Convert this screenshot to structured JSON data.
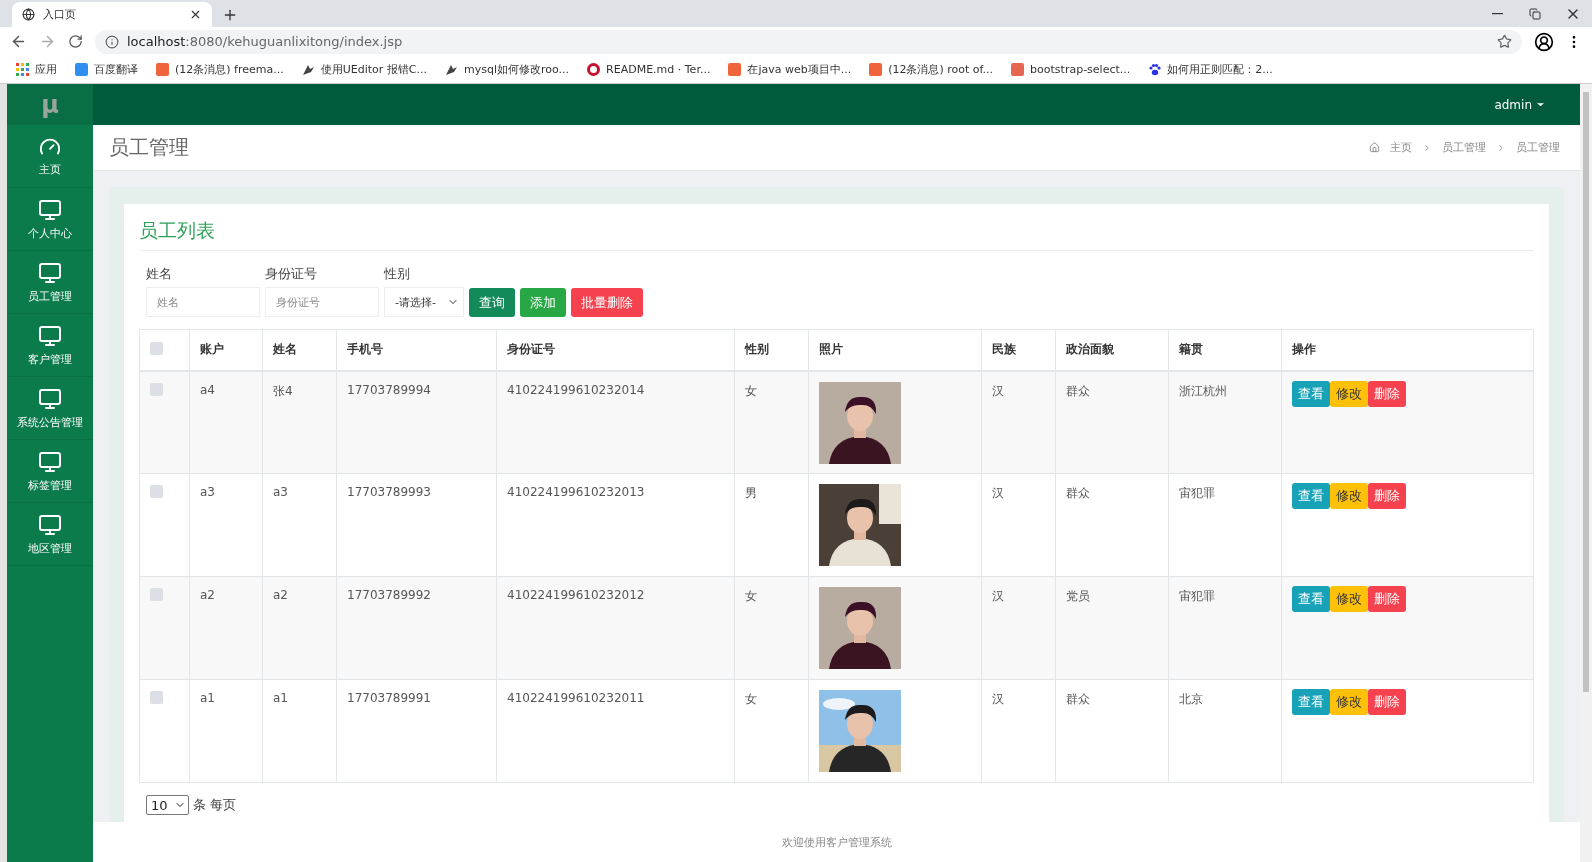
{
  "browser": {
    "tab": {
      "title": "入口页"
    },
    "url_host": "localhost",
    "url_rest": ":8080/kehuguanlixitong/index.jsp",
    "bookmarks": [
      {
        "kind": "apps",
        "label": "应用"
      },
      {
        "kind": "site",
        "label": "百度翻译",
        "color": "#2f8ff0"
      },
      {
        "kind": "site",
        "label": "(12条消息) freema...",
        "color": "#f0643c"
      },
      {
        "kind": "bird",
        "label": "使用UEditor 报错C...",
        "color": "#444444"
      },
      {
        "kind": "bird",
        "label": "mysql如何修改roo...",
        "color": "#444444"
      },
      {
        "kind": "round",
        "label": "README.md · Ter...",
        "color": "#c8102e"
      },
      {
        "kind": "site",
        "label": "在java web项目中...",
        "color": "#f0643c"
      },
      {
        "kind": "site",
        "label": "(12条消息) root of...",
        "color": "#f0643c"
      },
      {
        "kind": "site",
        "label": "bootstrap-select...",
        "color": "#e5674f"
      },
      {
        "kind": "paw",
        "label": "如何用正则匹配：2...",
        "color": "#2932e1"
      }
    ]
  },
  "app": {
    "logo": "μ",
    "user": "admin",
    "sidebar": [
      {
        "kind": "dashboard",
        "label": "主页"
      },
      {
        "kind": "monitor",
        "label": "个人中心"
      },
      {
        "kind": "monitor",
        "label": "员工管理"
      },
      {
        "kind": "monitor",
        "label": "客户管理"
      },
      {
        "kind": "monitor",
        "label": "系统公告管理"
      },
      {
        "kind": "monitor",
        "label": "标签管理"
      },
      {
        "kind": "monitor",
        "label": "地区管理"
      }
    ],
    "page_title": "员工管理",
    "breadcrumb": [
      "主页",
      "员工管理",
      "员工管理"
    ],
    "card_title": "员工列表",
    "filters": [
      {
        "kind": "input",
        "label": "姓名",
        "placeholder": "姓名"
      },
      {
        "kind": "input",
        "label": "身份证号",
        "placeholder": "身份证号"
      },
      {
        "kind": "select",
        "label": "性别",
        "value": "-请选择-"
      }
    ],
    "buttons": [
      {
        "kind": "query",
        "label": "查询"
      },
      {
        "kind": "add",
        "label": "添加"
      },
      {
        "kind": "delete",
        "label": "批量删除"
      }
    ],
    "table": {
      "select_all": {
        "checked": false
      },
      "columns": [
        "账户",
        "姓名",
        "手机号",
        "身份证号",
        "性别",
        "照片",
        "民族",
        "政治面貌",
        "籍贯",
        "操作"
      ],
      "rows": [
        {
          "checked": false,
          "cells": [
            "a4",
            "张4",
            "17703789994",
            "410224199610232014",
            "女"
          ],
          "photo": {
            "kind": "picture"
          },
          "cells2": [
            "汉",
            "群众",
            "浙江杭州"
          ],
          "actions": [
            "查看",
            "修改",
            "删除"
          ]
        },
        {
          "checked": false,
          "cells": [
            "a3",
            "a3",
            "17703789993",
            "410224199610232013",
            "男"
          ],
          "photo": {
            "kind": "picture"
          },
          "cells2": [
            "汉",
            "群众",
            "宙犯罪"
          ],
          "actions": [
            "查看",
            "修改",
            "删除"
          ]
        },
        {
          "checked": false,
          "cells": [
            "a2",
            "a2",
            "17703789992",
            "410224199610232012",
            "女"
          ],
          "photo": {
            "kind": "picture"
          },
          "cells2": [
            "汉",
            "党员",
            "宙犯罪"
          ],
          "actions": [
            "查看",
            "修改",
            "删除"
          ]
        },
        {
          "checked": false,
          "cells": [
            "a1",
            "a1",
            "17703789991",
            "410224199610232011",
            "女"
          ],
          "photo": {
            "kind": "picture"
          },
          "cells2": [
            "汉",
            "群众",
            "北京"
          ],
          "actions": [
            "查看",
            "修改",
            "删除"
          ]
        }
      ]
    },
    "page_size": "10",
    "page_size_label": "条 每页",
    "footer": "欢迎使用客户管理系统"
  }
}
